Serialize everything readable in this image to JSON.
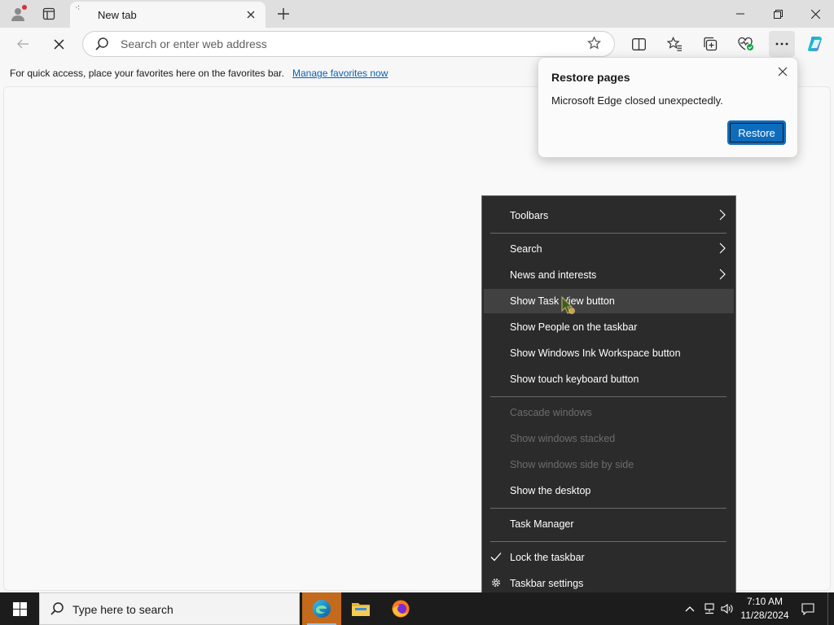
{
  "browser": {
    "tab": {
      "title": "New tab"
    },
    "address": {
      "placeholder": "Search or enter web address"
    },
    "favorites_bar": {
      "message": "For quick access, place your favorites here on the favorites bar.",
      "link": "Manage favorites now"
    }
  },
  "popup": {
    "title": "Restore pages",
    "message": "Microsoft Edge closed unexpectedly.",
    "button": "Restore"
  },
  "context_menu": {
    "items": [
      {
        "label": "Toolbars"
      },
      {
        "label": "Search"
      },
      {
        "label": "News and interests"
      },
      {
        "label": "Show Task View button"
      },
      {
        "label": "Show People on the taskbar"
      },
      {
        "label": "Show Windows Ink Workspace button"
      },
      {
        "label": "Show touch keyboard button"
      },
      {
        "label": "Cascade windows"
      },
      {
        "label": "Show windows stacked"
      },
      {
        "label": "Show windows side by side"
      },
      {
        "label": "Show the desktop"
      },
      {
        "label": "Task Manager"
      },
      {
        "label": "Lock the taskbar"
      },
      {
        "label": "Taskbar settings"
      }
    ]
  },
  "taskbar": {
    "search_text": "Type here to search",
    "time": "7:10 AM",
    "date": "11/28/2024"
  },
  "colors": {
    "accent": "#0f6cbd",
    "menu_bg": "#2b2b2b",
    "taskbar_bg": "#1c1c1c",
    "active_app": "#c46a1d"
  }
}
